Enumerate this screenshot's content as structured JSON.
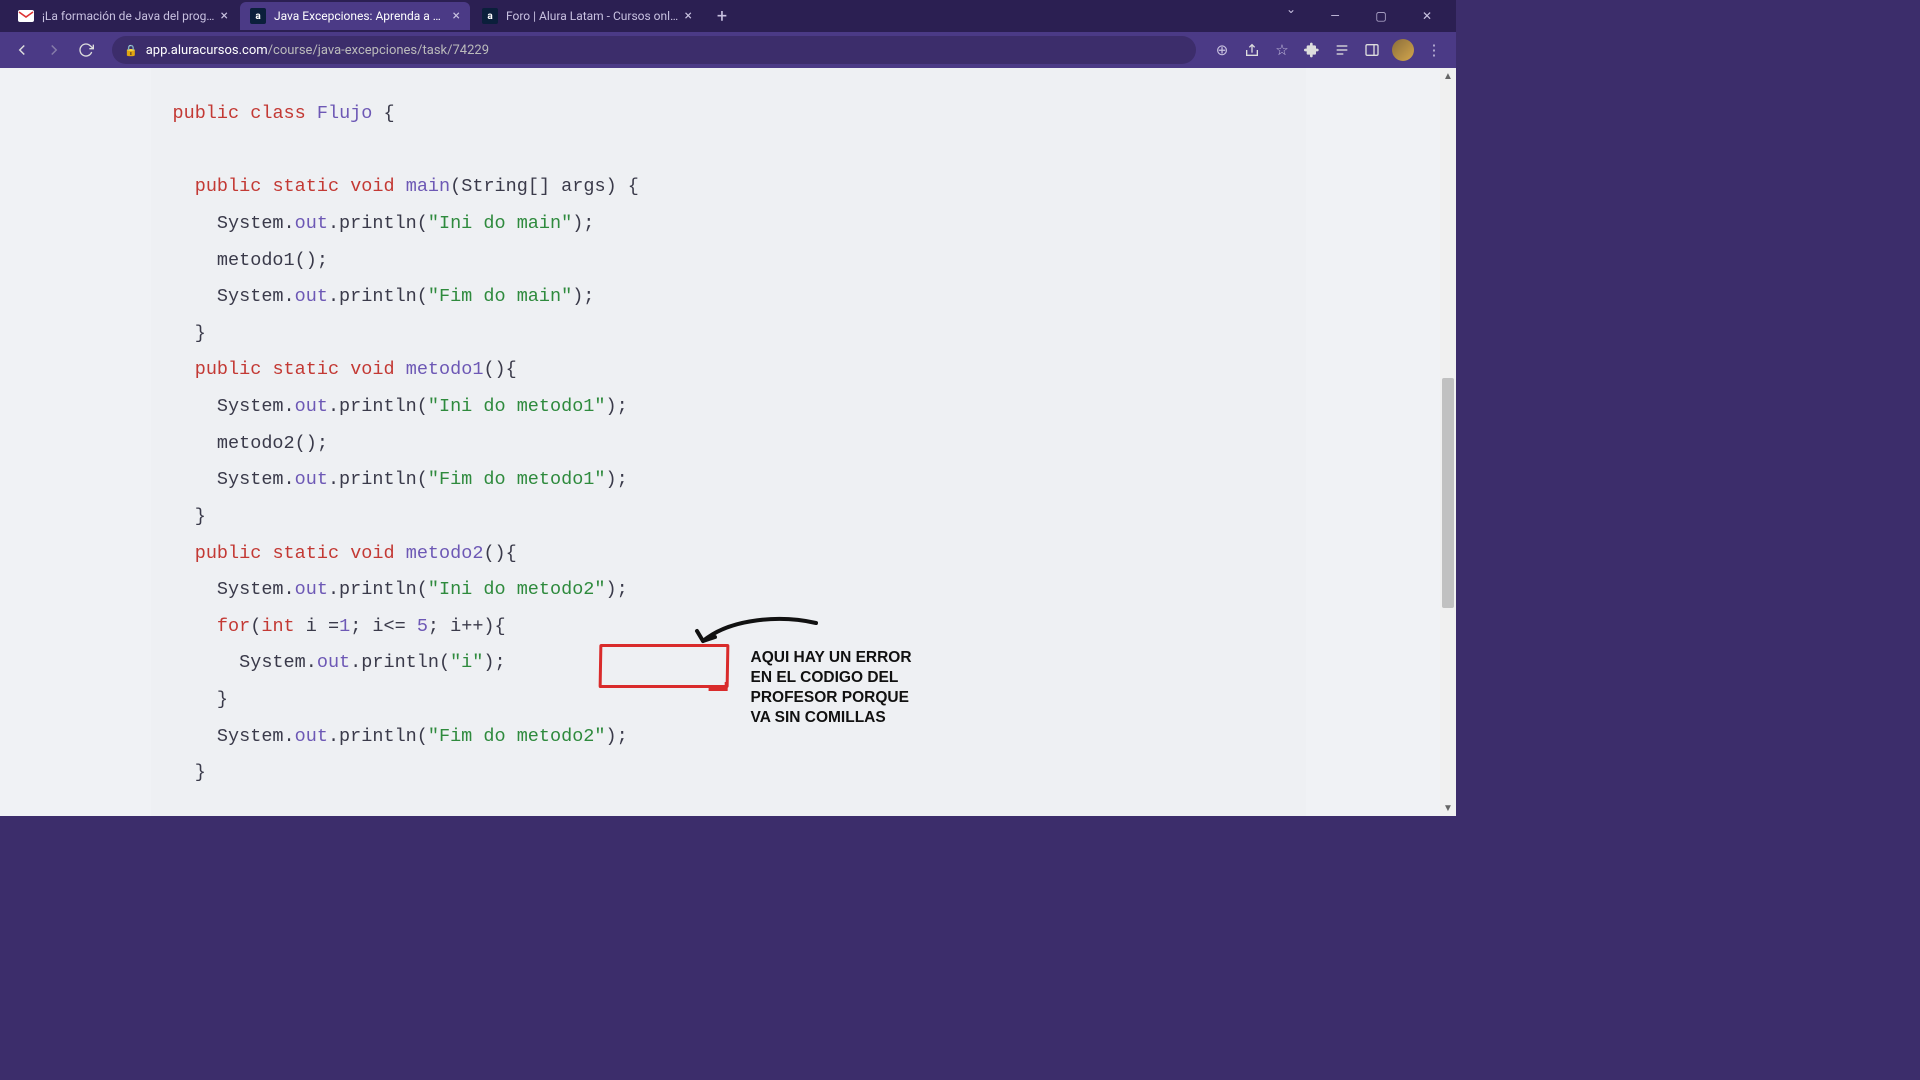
{
  "browser": {
    "tabs": [
      {
        "title": "¡La formación de Java del progra",
        "icon": "M"
      },
      {
        "title": "Java Excepciones: Aprenda a cre",
        "icon": "a"
      },
      {
        "title": "Foro | Alura Latam - Cursos onlin",
        "icon": "a"
      }
    ],
    "url_host": "app.aluracursos.com",
    "url_path": "/course/java-excepciones/task/74229"
  },
  "code": {
    "l1_public": "public",
    "l1_class": "class",
    "l1_name": "Flujo",
    "l1_rest": " {",
    "l3_sig1": "public",
    "l3_sig2": "static",
    "l3_sig3": "void",
    "l3_name": "main",
    "l3_params": "(String[] args) {",
    "l4a": "System.",
    "l4b": "out",
    "l4c": ".println(",
    "l4s": "\"Ini do main\"",
    "l4d": ");",
    "l5": "metodo1();",
    "l6a": "System.",
    "l6b": "out",
    "l6c": ".println(",
    "l6s": "\"Fim do main\"",
    "l6d": ");",
    "l7": "}",
    "m1_sig1": "public",
    "m1_sig2": "static",
    "m1_sig3": "void",
    "m1_name": "metodo1",
    "m1_params": "(){",
    "m1l1a": "System.",
    "m1l1b": "out",
    "m1l1c": ".println(",
    "m1l1s": "\"Ini do metodo1\"",
    "m1l1d": ");",
    "m1l2": "metodo2();",
    "m1l3a": "System.",
    "m1l3b": "out",
    "m1l3c": ".println(",
    "m1l3s": "\"Fim do metodo1\"",
    "m1l3d": ");",
    "m1l4": "}",
    "m2_sig1": "public",
    "m2_sig2": "static",
    "m2_sig3": "void",
    "m2_name": "metodo2",
    "m2_params": "(){",
    "m2l1a": "System.",
    "m2l1b": "out",
    "m2l1c": ".println(",
    "m2l1s": "\"Ini do metodo2\"",
    "m2l1d": ");",
    "m2_for": "for",
    "m2_int": "int",
    "m2_forrest1": " i =",
    "m2_num1": "1",
    "m2_forrest2": "; i<= ",
    "m2_num5": "5",
    "m2_forrest3": "; i++){",
    "m2_pa": "System.",
    "m2_pb": "out",
    "m2_pc": ".println(",
    "m2_ps": "\"i\"",
    "m2_pd": ");",
    "m2_cb": "}",
    "m2l3a": "System.",
    "m2l3b": "out",
    "m2l3c": ".println(",
    "m2l3s": "\"Fim do metodo2\"",
    "m2l3d": ");",
    "m2l4": "}"
  },
  "annotation": {
    "text": "AQUI HAY UN ERROR\nEN EL CODIGO DEL\nPROFESOR PORQUE\nVA SIN COMILLAS"
  }
}
